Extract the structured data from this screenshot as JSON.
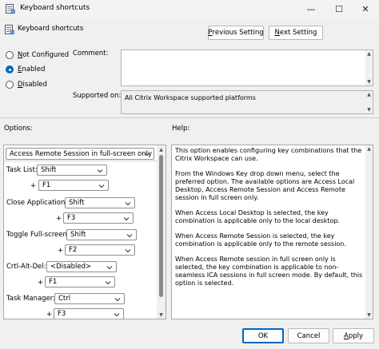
{
  "window": {
    "title": "Keyboard shortcuts",
    "minimize_glyph": "—",
    "maximize_glyph": "☐",
    "close_glyph": "✕"
  },
  "header": {
    "policy_title": "Keyboard shortcuts",
    "prev_prefix": "",
    "prev_underline": "P",
    "prev_rest": "revious Setting",
    "next_underline": "N",
    "next_rest": "ext Setting"
  },
  "state": {
    "not_configured_prefix": "",
    "not_configured_ul": "N",
    "not_configured_rest": "ot Configured",
    "enabled_ul": "E",
    "enabled_rest": "nabled",
    "disabled_ul": "D",
    "disabled_rest": "isabled",
    "selected": "enabled"
  },
  "comment": {
    "label": "Comment:",
    "value": ""
  },
  "supported": {
    "label": "Supported on:",
    "value": "All Citrix Workspace supported platforms"
  },
  "options": {
    "label": "Options:",
    "mode_value": "Access Remote Session in full-screen only",
    "plus": "+",
    "rows": [
      {
        "label": "Task List:",
        "mod": "Shift",
        "key": "F1"
      },
      {
        "label": "Close Application:",
        "mod": "Shift",
        "key": "F3"
      },
      {
        "label": "Toggle Full-screen:",
        "mod": "Shift",
        "key": "F2"
      },
      {
        "label": "Crtl-Alt-Del:",
        "mod": "<Disabled>",
        "key": "F1"
      },
      {
        "label": "Task Manager:",
        "mod": "Ctrl",
        "key": "F3"
      }
    ]
  },
  "help": {
    "label": "Help:",
    "paragraphs": [
      "This option enables configuring key combinations that the Citrix Workspace can use.",
      "From the Windows Key drop down menu, select the preferred option. The available options are Access Local Desktop, Access Remote Session and Access Remote session in full screen only.",
      "When Access Local Desktop is selected, the key combination is applicable only to the local desktop.",
      "When Access Remote Session is selected, the key combination is applicable only to the remote session.",
      "When Access Remote session in full screen only is selected, the key combination is applicable to non-seamless ICA sessions in full screen mode. By default, this option is selected."
    ]
  },
  "footer": {
    "ok_label": "OK",
    "cancel_label": "Cancel",
    "apply_ul": "A",
    "apply_rest": "pply"
  },
  "colors": {
    "accent": "#0067c0",
    "background": "#f0f0f0"
  }
}
